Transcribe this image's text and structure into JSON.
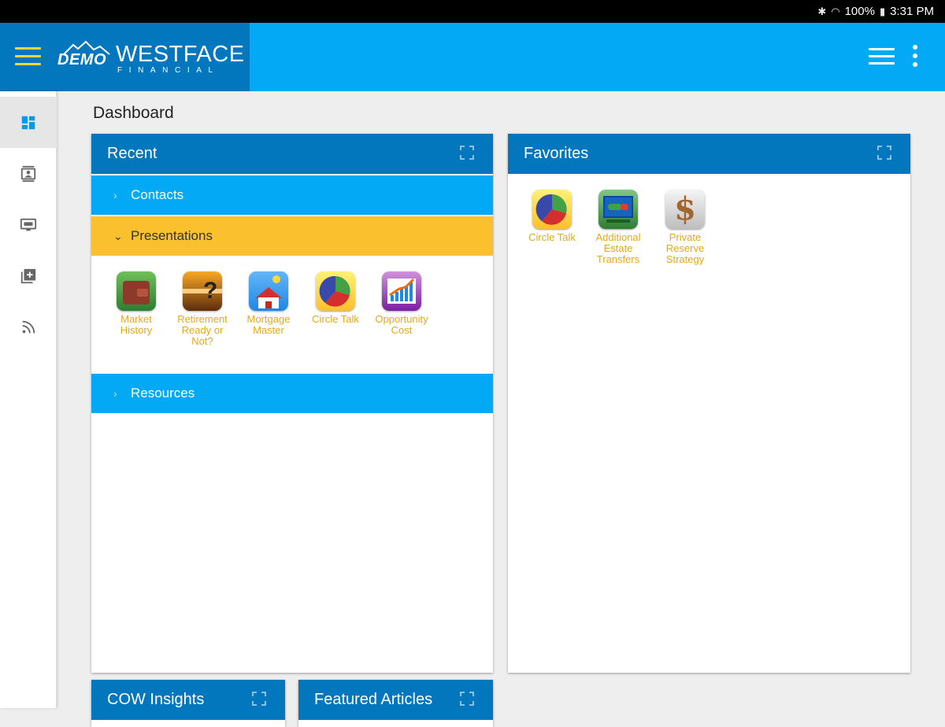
{
  "status_bar": {
    "battery": "100%",
    "time": "3:31 PM"
  },
  "header": {
    "logo_badge": "DEMO",
    "logo_name": "WESTFACE",
    "logo_subtitle": "FINANCIAL"
  },
  "rail": {
    "items": [
      {
        "icon": "dashboard-icon"
      },
      {
        "icon": "contacts-icon"
      },
      {
        "icon": "presentation-icon"
      },
      {
        "icon": "library-add-icon"
      },
      {
        "icon": "rss-feed-icon"
      }
    ]
  },
  "page": {
    "title": "Dashboard"
  },
  "recent": {
    "title": "Recent",
    "sections": {
      "contacts": "Contacts",
      "presentations": "Presentations",
      "resources": "Resources"
    },
    "presentations": [
      {
        "label_lines": [
          "Market",
          "History"
        ],
        "icon": "wallet-icon"
      },
      {
        "label_lines": [
          "Retirement",
          "Ready or",
          "Not?"
        ],
        "icon": "sunset-question-icon"
      },
      {
        "label_lines": [
          "Mortgage",
          "Master"
        ],
        "icon": "house-icon"
      },
      {
        "label_lines": [
          "Circle Talk"
        ],
        "icon": "pie-chart-icon"
      },
      {
        "label_lines": [
          "Opportunity",
          "Cost"
        ],
        "icon": "growth-chart-icon"
      }
    ]
  },
  "favorites": {
    "title": "Favorites",
    "items": [
      {
        "label_lines": [
          "Circle Talk"
        ],
        "icon": "pie-chart-icon"
      },
      {
        "label_lines": [
          "Additional",
          "Estate",
          "Transfers"
        ],
        "icon": "estate-chart-icon"
      },
      {
        "label_lines": [
          "Private",
          "Reserve",
          "Strategy"
        ],
        "icon": "dollar-sign-icon"
      }
    ]
  },
  "cow_insights": {
    "title": "COW Insights"
  },
  "featured_articles": {
    "title": "Featured Articles"
  },
  "colors": {
    "primary_dark": "#0277bd",
    "primary": "#03a9f4",
    "accent": "#fbc02d",
    "label": "#e6a817"
  }
}
